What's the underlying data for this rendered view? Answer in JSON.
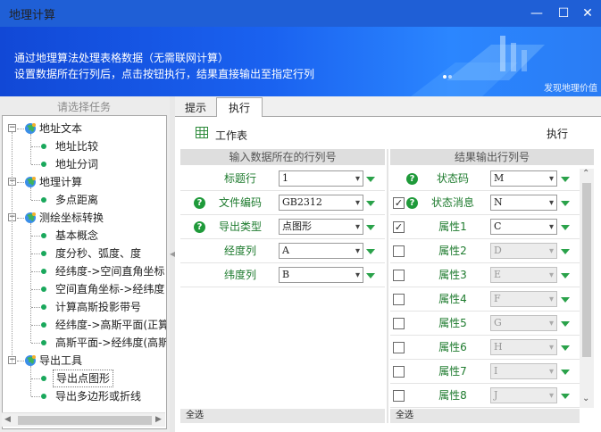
{
  "window": {
    "title": "地理计算",
    "min": "—",
    "max": "☐",
    "close": "✕"
  },
  "banner": {
    "line1": "通过地理算法处理表格数据（无需联网计算）",
    "line2": "设置数据所在行列后，点击按钮执行，结果直接输出至指定行列",
    "slogan": "发现地理价值"
  },
  "left": {
    "header": "请选择任务",
    "tree": [
      {
        "label": "地址文本",
        "children": [
          "地址比较",
          "地址分词"
        ]
      },
      {
        "label": "地理计算",
        "children": [
          "多点距离"
        ]
      },
      {
        "label": "测绘坐标转换",
        "children": [
          "基本概念",
          "度分秒、弧度、度",
          "经纬度->空间直角坐标",
          "空间直角坐标->经纬度",
          "计算高斯投影带号",
          "经纬度->高斯平面(正算",
          "高斯平面->经纬度(高斯"
        ]
      },
      {
        "label": "导出工具",
        "children": [
          "导出点图形",
          "导出多边形或折线"
        ]
      }
    ],
    "selected": "导出点图形"
  },
  "tabs": {
    "hint": "提示",
    "exec": "执行"
  },
  "toolbar": {
    "sheet": "工作表",
    "run": "执行"
  },
  "input_panel": {
    "header": "输入数据所在的行列号",
    "rows": [
      {
        "label": "标题行",
        "value": "1",
        "help": false
      },
      {
        "label": "文件编码",
        "value": "GB2312",
        "help": true
      },
      {
        "label": "导出类型",
        "value": "点图形",
        "help": true
      },
      {
        "label": "经度列",
        "value": "A",
        "help": false
      },
      {
        "label": "纬度列",
        "value": "B",
        "help": false
      }
    ],
    "select_all": "全选"
  },
  "output_panel": {
    "header": "结果输出行列号",
    "rows": [
      {
        "label": "状态码",
        "value": "M",
        "checkbox": false,
        "checked": false,
        "help": true,
        "enabled": true
      },
      {
        "label": "状态消息",
        "value": "N",
        "checkbox": true,
        "checked": true,
        "help": true,
        "enabled": true
      },
      {
        "label": "属性1",
        "value": "C",
        "checkbox": true,
        "checked": true,
        "help": false,
        "enabled": true
      },
      {
        "label": "属性2",
        "value": "D",
        "checkbox": true,
        "checked": false,
        "help": false,
        "enabled": false
      },
      {
        "label": "属性3",
        "value": "E",
        "checkbox": true,
        "checked": false,
        "help": false,
        "enabled": false
      },
      {
        "label": "属性4",
        "value": "F",
        "checkbox": true,
        "checked": false,
        "help": false,
        "enabled": false
      },
      {
        "label": "属性5",
        "value": "G",
        "checkbox": true,
        "checked": false,
        "help": false,
        "enabled": false
      },
      {
        "label": "属性6",
        "value": "H",
        "checkbox": true,
        "checked": false,
        "help": false,
        "enabled": false
      },
      {
        "label": "属性7",
        "value": "I",
        "checkbox": true,
        "checked": false,
        "help": false,
        "enabled": false
      },
      {
        "label": "属性8",
        "value": "J",
        "checkbox": true,
        "checked": false,
        "help": false,
        "enabled": false
      }
    ],
    "select_all": "全选"
  },
  "icons": {
    "help": "?",
    "check": "✓",
    "arrow": "▾",
    "expander": "−"
  },
  "colors": {
    "titlebar": "#1f5fd6",
    "label_green": "#1e7b2e",
    "dot_green": "#1aa85c"
  }
}
